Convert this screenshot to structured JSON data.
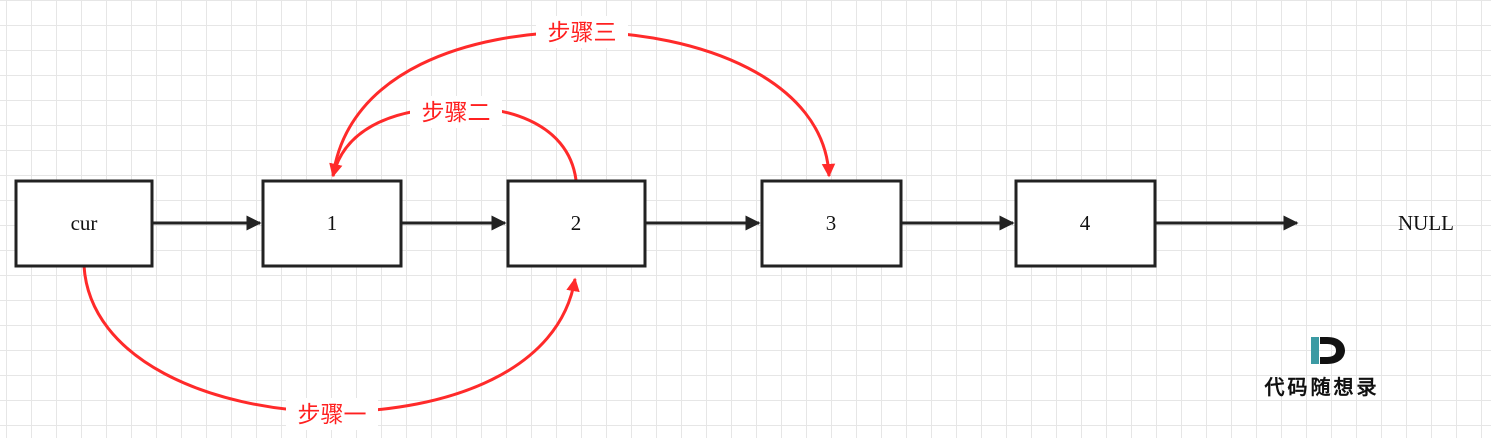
{
  "diagram": {
    "nodes": [
      {
        "id": "cur",
        "label": "cur"
      },
      {
        "id": "n1",
        "label": "1"
      },
      {
        "id": "n2",
        "label": "2"
      },
      {
        "id": "n3",
        "label": "3"
      },
      {
        "id": "n4",
        "label": "4"
      }
    ],
    "terminal_label": "NULL",
    "steps": {
      "step1": "步骤一",
      "step2": "步骤二",
      "step3": "步骤三"
    },
    "colors": {
      "grid": "#e6e6e6",
      "node_border": "#222222",
      "arrow": "#222222",
      "step_arrow": "#ff2a2a",
      "logo_teal": "#3b9aa3"
    },
    "watermark": {
      "logo_letter": "D",
      "text": "代码随想录"
    }
  }
}
